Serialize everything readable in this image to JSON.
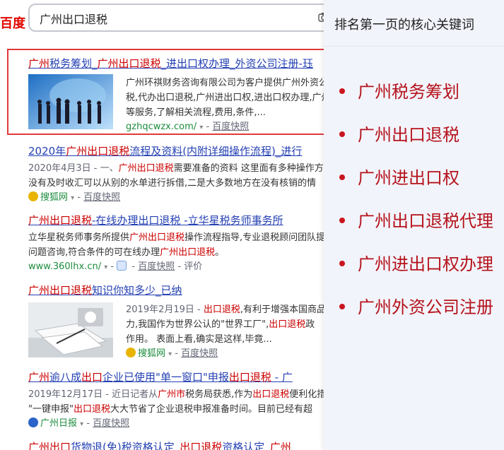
{
  "search": {
    "logo_text": "百度",
    "query": "广州出口退税"
  },
  "results": [
    {
      "title_parts": [
        "广州",
        "税务筹划",
        "_",
        "广州出口退税",
        "_进出口权办理_外资公司注册-珏"
      ],
      "text": "广州环祺财务咨询有限公司为客户提供广州外资公司...税代办出口退税,广州进出口权,进出口权办理,广州...等服务,了解相关流程,费用,条件,...",
      "text_lines": [
        "广州环祺财务咨询有限公司为客户提供广州外资公",
        "税,代办出口退税,广州进出口权,进出口权办理,广州",
        "等服务,了解相关流程,费用,条件,..."
      ],
      "site": "gzhqcwzx.com/",
      "snapshot": "百度快照"
    },
    {
      "title_parts": [
        "2020年",
        "广州出口退税",
        "流程及资料(内附详细操作流程)_进行"
      ],
      "date": "2020年4月3日",
      "line1_parts": [
        "2020年4月3日 - 一、",
        "广州出口退税",
        "需要准备的资料 这里面有多种操作方"
      ],
      "line2": "没有及时收汇可以从别的水单进行拆借,二是大多数地方在没有核销的情",
      "site": "搜狐网",
      "snapshot": "百度快照"
    },
    {
      "title_parts": [
        "广州出口退税",
        "-在线办理出口退税 -立华星税务师事务所"
      ],
      "line1_parts": [
        "立华星税务师事务所提供",
        "广州出口退税",
        "操作流程指导,专业退税顾问团队提"
      ],
      "line2_parts": [
        "问题咨询,符合条件的可在线办理",
        "广州出口退税",
        "。"
      ],
      "site": "www.360lhx.cn/",
      "snapshot": "百度快照",
      "rating": "评价"
    },
    {
      "title_parts": [
        "广州出口退税",
        "知识你知多少_已纳"
      ],
      "line1_parts": [
        "2019年2月19日 - ",
        "出口退税",
        ",有利于增强本国商品"
      ],
      "line2_parts": [
        "力,我国作为世界公认的\"世界工厂\",",
        "出口退税",
        "政"
      ],
      "line3": "作用。 表面上看,确实是这样,毕竟...",
      "site": "搜狐网",
      "snapshot": "百度快照"
    },
    {
      "title_parts": [
        "广州",
        "逾八成",
        "出口",
        "企业已使用\"单一窗口\"申报",
        "出口退税",
        " - 广"
      ],
      "line1_parts": [
        "2019年12月17日 - 近日记者从",
        "广州市",
        "税务局获悉,作为",
        "出口退税",
        "便利化措"
      ],
      "line2_parts": [
        "\"一键申报\"",
        "出口退税",
        "大大节省了企业退税申报准备时间。目前已经有超"
      ],
      "site": "广州日报",
      "snapshot": "百度快照"
    },
    {
      "title_parts": [
        "广州出口",
        "货物退(免)税资格认定_",
        "出口退税",
        "资格认定_",
        "广州"
      ]
    }
  ],
  "panel": {
    "title": "排名第一页的核心关键词",
    "keywords": [
      "广州税务筹划",
      "广州出口退税",
      "广州进出口权",
      "广州出口退税代理",
      "广州进出口权办理",
      "广州外资公司注册"
    ]
  },
  "colors": {
    "link": "#2440b3",
    "highlight": "#cc0000",
    "site_green": "#1e8c3e",
    "keyword_red": "#b5121b",
    "box_red": "#e03a3a"
  }
}
